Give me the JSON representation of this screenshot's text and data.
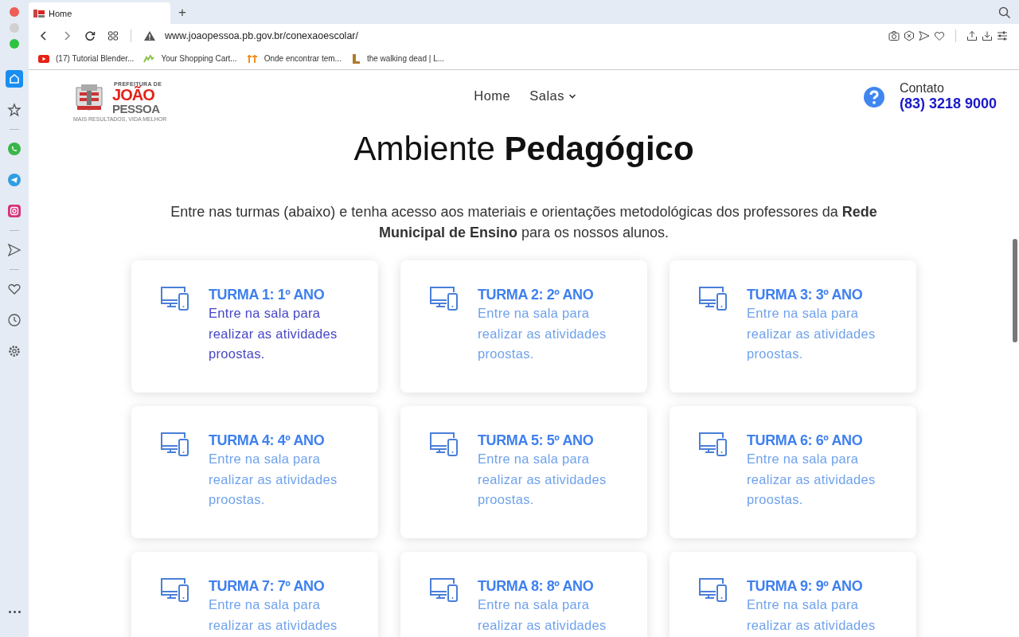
{
  "browser": {
    "tab": {
      "title": "Home"
    },
    "new_tab": "+",
    "url": "www.joaopessoa.pb.gov.br/conexaoescolar/",
    "bookmarks": [
      {
        "kind": "video",
        "label": "(17) Tutorial Blender..."
      },
      {
        "kind": "cart",
        "label": "Your Shopping Cart..."
      },
      {
        "kind": "tt",
        "label": "Onde encontrar tem..."
      },
      {
        "kind": "letter",
        "label": "the walking dead | L..."
      }
    ],
    "sidebar": [
      {
        "kind": "home",
        "selected": true
      },
      {
        "kind": "star",
        "selected": false
      },
      {
        "kind": "divider"
      },
      {
        "kind": "whatsapp",
        "selected": false
      },
      {
        "kind": "telegram",
        "selected": false
      },
      {
        "kind": "instagram",
        "selected": false
      },
      {
        "kind": "divider"
      },
      {
        "kind": "send",
        "selected": false
      },
      {
        "kind": "divider"
      },
      {
        "kind": "heart",
        "selected": false
      },
      {
        "kind": "clock",
        "selected": false
      },
      {
        "kind": "settings",
        "selected": false
      }
    ]
  },
  "page": {
    "logo": {
      "top": "PREFEITURA DE",
      "name1": "JOÃO",
      "name2": "PESSOA",
      "slogan": "MAIS RESULTADOS, VIDA MELHOR"
    },
    "nav": [
      {
        "label": "Home",
        "dropdown": false
      },
      {
        "label": "Salas",
        "dropdown": true
      }
    ],
    "contact": {
      "label": "Contato",
      "phone": "(83) 3218 9000"
    },
    "heading": "Ambiente **Pedagógico**",
    "intro": "Entre nas turmas (abaixo) e tenha acesso aos materiais e orientações metodológicas dos professores da **Rede Municipal de Ensino** para os nossos alunos.",
    "cards": [
      {
        "title": "TURMA 1: 1º ANO",
        "text": "Entre na sala para realizar as atividades proostas.",
        "hovered": true
      },
      {
        "title": "TURMA 2: 2º ANO",
        "text": "Entre na sala para realizar as atividades proostas.",
        "hovered": false
      },
      {
        "title": "TURMA 3: 3º ANO",
        "text": "Entre na sala para realizar as atividades proostas.",
        "hovered": false
      },
      {
        "title": "TURMA 4: 4º ANO",
        "text": "Entre na sala para realizar as atividades proostas.",
        "hovered": false
      },
      {
        "title": "TURMA 5: 5º ANO",
        "text": "Entre na sala para realizar as atividades proostas.",
        "hovered": false
      },
      {
        "title": "TURMA 6: 6º ANO",
        "text": "Entre na sala para realizar as atividades proostas.",
        "hovered": false
      },
      {
        "title": "TURMA 7: 7º ANO",
        "text": "Entre na sala para realizar as atividades",
        "hovered": false
      },
      {
        "title": "TURMA 8: 8º ANO",
        "text": "Entre na sala para realizar as atividades",
        "hovered": false
      },
      {
        "title": "TURMA 9: 9º ANO",
        "text": "Entre na sala para realizar as atividades",
        "hovered": false
      }
    ]
  }
}
